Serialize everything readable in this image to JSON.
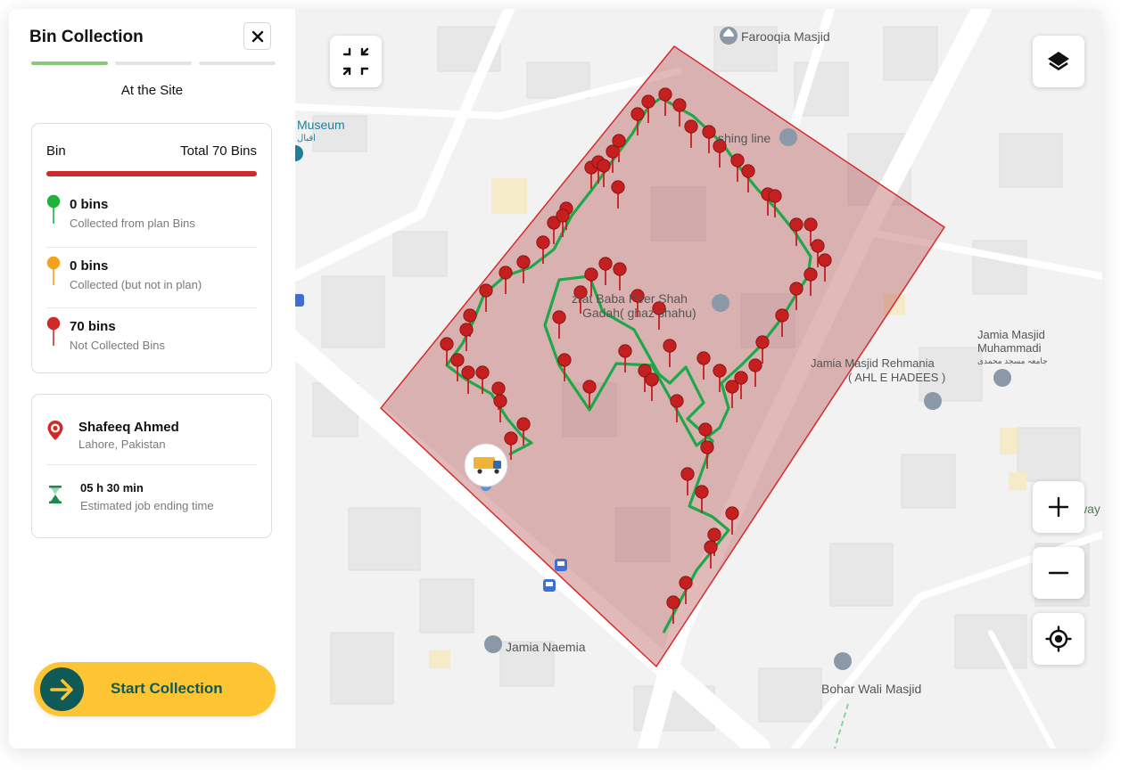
{
  "sidebar": {
    "title": "Bin Collection",
    "step_label": "At the Site",
    "bin_card": {
      "header_label": "Bin",
      "total_label": "Total 70 Bins",
      "rows": [
        {
          "count": "0 bins",
          "desc": "Collected from plan Bins",
          "color": "#1bb33a"
        },
        {
          "count": "0 bins",
          "desc": "Collected (but not in plan)",
          "color": "#f4a21b"
        },
        {
          "count": "70 bins",
          "desc": "Not Collected Bins",
          "color": "#cf2a27"
        }
      ]
    },
    "info_card": {
      "name": "Shafeeq Ahmed",
      "location": "Lahore, Pakistan",
      "time": "05 h 30 min",
      "time_desc": "Estimated job ending time"
    },
    "start_button": "Start Collection",
    "icons": {
      "close": "close-icon",
      "location": "location-pin-icon",
      "hourglass": "hourglass-icon",
      "arrow": "arrow-right-icon"
    }
  },
  "map": {
    "poi": {
      "farooqia": "Farooqia Masjid",
      "museum": "Museum",
      "museum_urdu": "اقبال",
      "fishing": "shing line",
      "darbar1": "zrat Baba Peer Shah",
      "darbar2": "Gadah( ghaz shahu)",
      "jamia_muhammadi1": "Jamia Masjid",
      "jamia_muhammadi2": "Muhammadi",
      "jamia_muhammadi_urdu": "جامعہ مسجد محمدی",
      "jamia_rehmania1": "Jamia Masjid Rehmania",
      "jamia_rehmania2": "( AHL E HADEES )",
      "naemia": "Jamia Naemia",
      "bohar": "Bohar Wali Masjid",
      "road": "way"
    },
    "colors": {
      "zone_fill": "#b34848",
      "zone_stroke": "#d62b2b",
      "route": "#1ea84a",
      "pin": "#c61f1f"
    },
    "controls": [
      "collapse-icon",
      "layers-icon",
      "zoom-in-icon",
      "zoom-out-icon",
      "locate-icon"
    ]
  }
}
